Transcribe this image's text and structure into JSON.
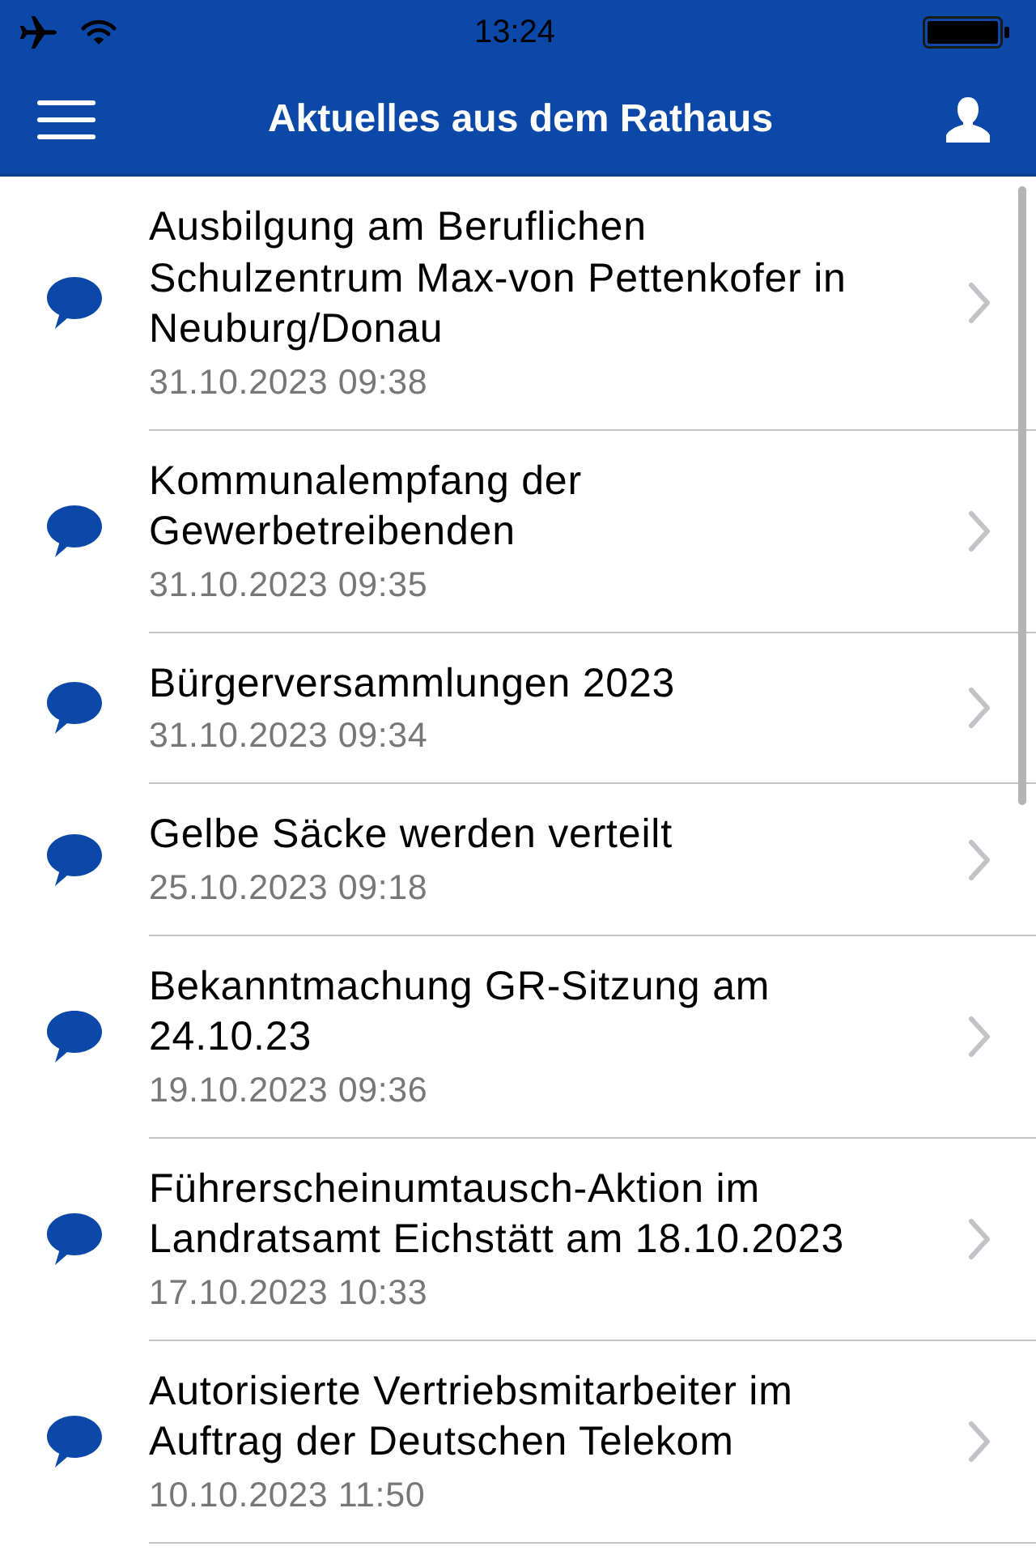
{
  "status_bar": {
    "time": "13:24"
  },
  "nav_bar": {
    "title": "Aktuelles aus dem Rathaus"
  },
  "news": [
    {
      "title": "Ausbilgung am Beruflichen Schulzentrum Max-von Pettenkofer in Neuburg/Donau",
      "date": "31.10.2023 09:38"
    },
    {
      "title": "Kommunalempfang der Gewerbetreibenden",
      "date": "31.10.2023 09:35"
    },
    {
      "title": "Bürgerversammlungen 2023",
      "date": "31.10.2023 09:34"
    },
    {
      "title": "Gelbe Säcke werden verteilt",
      "date": "25.10.2023 09:18"
    },
    {
      "title": "Bekanntmachung GR-Sitzung am 24.10.23",
      "date": "19.10.2023 09:36"
    },
    {
      "title": "Führerscheinumtausch-Aktion im Landratsamt Eichstätt am 18.10.2023",
      "date": "17.10.2023 10:33"
    },
    {
      "title": "Autorisierte Vertriebsmitarbeiter im Auftrag der Deutschen Telekom",
      "date": "10.10.2023 11:50"
    }
  ]
}
